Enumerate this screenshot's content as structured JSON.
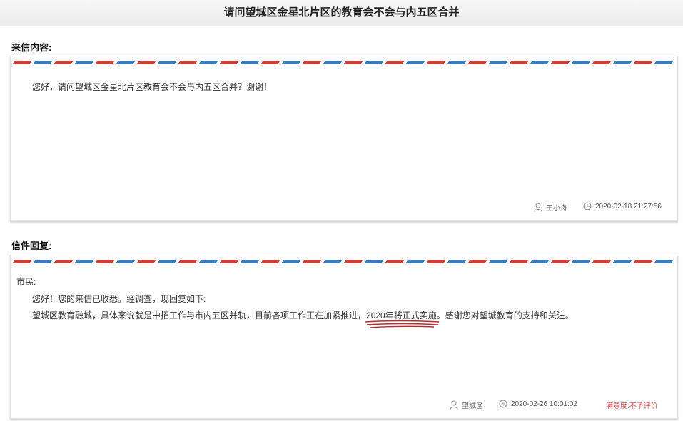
{
  "title": "请问望城区金星北片区的教育会不会与内五区合并",
  "letter": {
    "label": "来信内容:",
    "content": "您好，请问望城区金星北片区教育会不会与内五区合并？谢谢！",
    "author": "王小舟",
    "datetime": "2020-02-18 21:27:56"
  },
  "reply": {
    "label": "信件回复:",
    "salutation": "市民:",
    "line1": "您好！您的来信已收悉。经调查，现回复如下:",
    "line2_before": "望城区教育融城，具体来说就是中招工作与市内五区并轨，目前各项工作正在加紧推进，",
    "line2_highlight": "2020年将正式实施",
    "line2_after": "。感谢您对望城教育的支持和关注。",
    "author": "望城区",
    "datetime": "2020-02-26 10:01:02",
    "rating_label": "满意度:",
    "rating_value": "不予评价"
  },
  "icons": {
    "user": "user-icon",
    "clock": "clock-icon"
  },
  "colors": {
    "airmail_red": "#c9423a",
    "airmail_blue": "#3e79b8",
    "rating": "#d9534f",
    "annotation": "#c0272d"
  }
}
